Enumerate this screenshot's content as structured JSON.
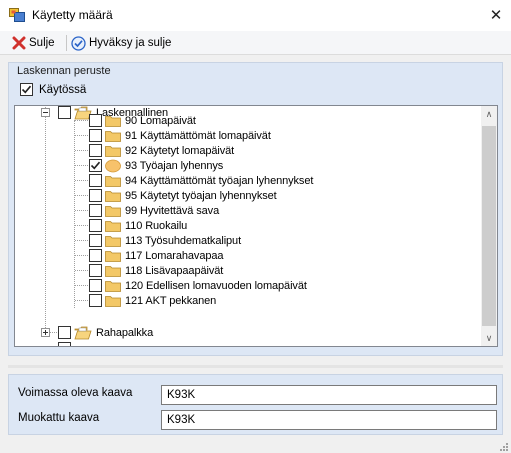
{
  "window": {
    "title": "Käytetty määrä"
  },
  "toolbar": {
    "close_label": "Sulje",
    "accept_label": "Hyväksy ja sulje"
  },
  "panel": {
    "title": "Laskennan peruste",
    "enabled_label": "Käytössä",
    "enabled_checked": true
  },
  "tree": {
    "groups": [
      {
        "label": "Laskennallinen",
        "expanded": true
      },
      {
        "label": "Rahapalkka",
        "expanded": false
      }
    ],
    "items": [
      {
        "label": "90 Lomapäivät",
        "checked": false
      },
      {
        "label": "91 Käyttämättömät lomapäivät",
        "checked": false
      },
      {
        "label": "92 Käytetyt lomapäivät",
        "checked": false
      },
      {
        "label": "93 Työajan lyhennys",
        "checked": true
      },
      {
        "label": "94 Käyttämättömät työajan lyhennykset",
        "checked": false
      },
      {
        "label": "95 Käytetyt työajan lyhennykset",
        "checked": false
      },
      {
        "label": "99 Hyvitettävä sava",
        "checked": false
      },
      {
        "label": "110 Ruokailu",
        "checked": false
      },
      {
        "label": "113 Työsuhdematkaliput",
        "checked": false
      },
      {
        "label": "117 Lomarahavapaa",
        "checked": false
      },
      {
        "label": "118 Lisävapaapäivät",
        "checked": false
      },
      {
        "label": "120 Edellisen lomavuoden lomapäivät",
        "checked": false
      },
      {
        "label": "121 AKT pekkanen",
        "checked": false
      }
    ]
  },
  "formula": {
    "current_label": "Voimassa oleva kaava",
    "current_value": "K93K",
    "modified_label": "Muokattu kaava",
    "modified_value": "K93K"
  },
  "colors": {
    "panel_bg": "#dde7f5",
    "folder": "#f3c867",
    "selected_item": "#f7c26b",
    "close_icon": "#d0312d",
    "accept_icon": "#2a63c7"
  }
}
